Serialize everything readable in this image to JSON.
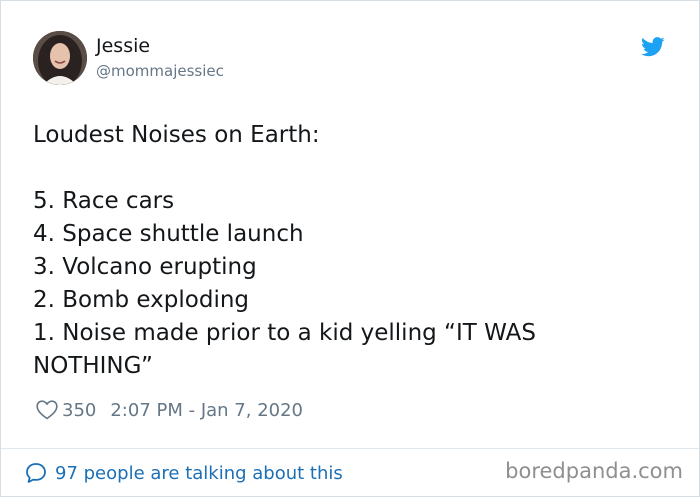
{
  "author": {
    "name": "Jessie",
    "handle": "@mommajessiec"
  },
  "tweet": {
    "lines": [
      "Loudest Noises on Earth:",
      "",
      "5. Race cars",
      "4. Space shuttle launch",
      "3. Volcano erupting",
      "2. Bomb exploding",
      "1. Noise made prior to a kid yelling “IT WAS",
      "NOTHING”"
    ]
  },
  "meta": {
    "likes": "350",
    "timestamp": "2:07 PM - Jan 7, 2020"
  },
  "footer": {
    "talking": "97 people are talking about this"
  },
  "watermark": "boredpanda.com",
  "colors": {
    "twitter_blue": "#1da1f2",
    "link_blue": "#1b6fb6",
    "muted_gray": "#657786"
  },
  "icons": {
    "brand": "twitter-bird-icon",
    "like": "heart-outline-icon",
    "reply": "speech-bubble-icon"
  }
}
